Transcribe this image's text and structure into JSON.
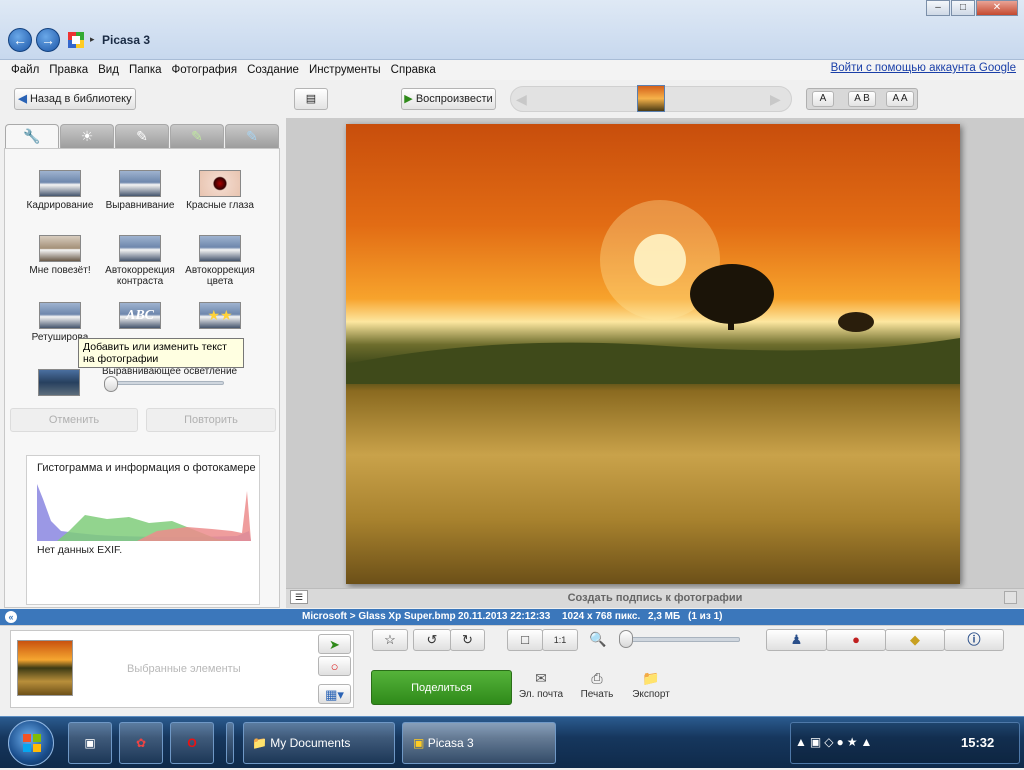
{
  "window": {
    "title": "Picasa 3",
    "back_glyph": "←",
    "forward_glyph": "→",
    "min": "–",
    "max": "□",
    "close": "✕"
  },
  "menu": [
    "Файл",
    "Правка",
    "Вид",
    "Папка",
    "Фотография",
    "Создание",
    "Инструменты",
    "Справка"
  ],
  "google_link": "Войти с помощью аккаунта Google",
  "toolbar": {
    "back_label": "Назад в библиотеку",
    "play_label": "Воспроизвести",
    "view_a": "A",
    "view_ab": "A B",
    "view_aa": "A A"
  },
  "tools": {
    "crop": "Кадрирование",
    "straighten": "Выравнивание",
    "redeye": "Красные глаза",
    "lucky": "Мне повезёт!",
    "autocontrast": "Автокоррекция контраста",
    "autocolor": "Автокоррекция цвета",
    "retouch": "Ретуширова",
    "text_glyph": "ABC",
    "fill_light": "Выравнивающее осветление",
    "undo": "Отменить",
    "redo": "Повторить"
  },
  "tooltip": "Добавить или изменить текст на фотографии",
  "histogram": {
    "title": "Гистограмма и информация о фотокамере",
    "exif": "Нет данных EXIF."
  },
  "caption_placeholder": "Создать подпись к фотографии",
  "status": {
    "path": "Microsoft > Glass Xp Super.bmp",
    "date": "20.11.2013 22:12:33",
    "dims": "1024 x 768 пикс.",
    "size": "2,3 МБ",
    "count": "(1 из 1)"
  },
  "tray": {
    "label": "Выбранные элементы"
  },
  "actions": {
    "share": "Поделиться",
    "email": "Эл. почта",
    "print": "Печать",
    "export": "Экспорт",
    "zoom_1to1": "1:1"
  },
  "taskbar": {
    "tasks": [
      "My Documents",
      "Picasa 3"
    ],
    "clock": "15:32"
  },
  "colors": {
    "accent": "#3b77bb",
    "share_green": "#3f9c26",
    "taskbar": "#16375e"
  }
}
